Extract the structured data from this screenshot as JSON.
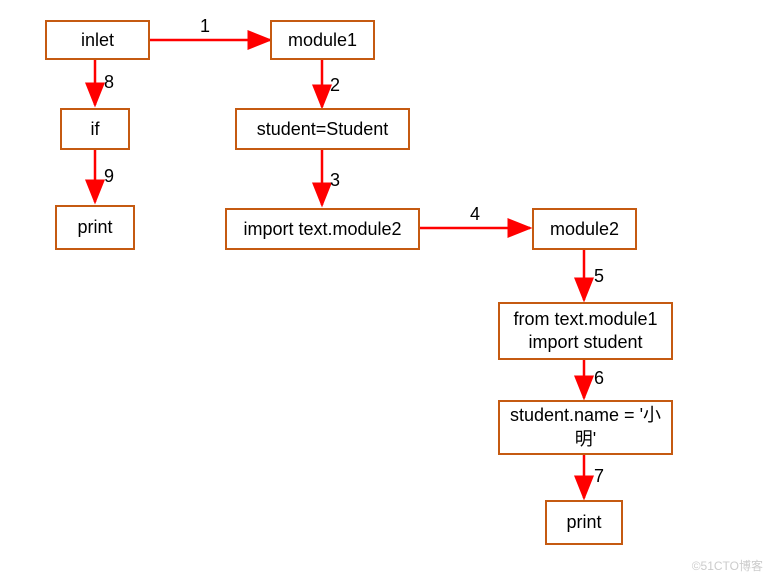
{
  "nodes": {
    "inlet": "inlet",
    "module1": "module1",
    "if": "if",
    "print1": "print",
    "studentAssign": "student=Student",
    "importModule2": "import text.module2",
    "module2": "module2",
    "fromImport": "from text.module1 import student",
    "studentName": "student.name = '小明'",
    "print2": "print"
  },
  "edges": {
    "e1": "1",
    "e2": "2",
    "e3": "3",
    "e4": "4",
    "e5": "5",
    "e6": "6",
    "e7": "7",
    "e8": "8",
    "e9": "9"
  },
  "watermark": "©51CTO博客"
}
